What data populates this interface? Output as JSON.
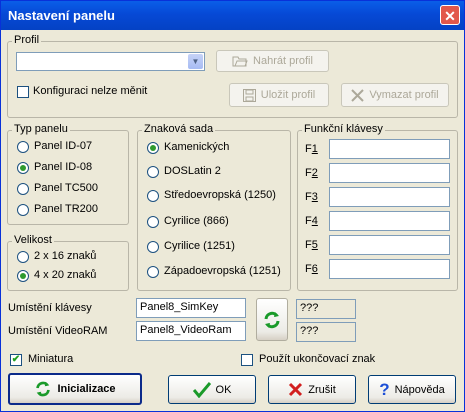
{
  "window": {
    "title": "Nastavení panelu",
    "close_symbol": "✕"
  },
  "profile": {
    "group_label": "Profil",
    "selected": "",
    "load_label": "Nahrát profil",
    "save_label": "Uložit profil",
    "delete_label": "Vymazat profil",
    "lock_label": "Konfiguraci nelze měnit",
    "lock_checked": false
  },
  "panel_type": {
    "group_label": "Typ panelu",
    "options": [
      "Panel ID-07",
      "Panel ID-08",
      "Panel TC500",
      "Panel TR200"
    ],
    "selected": "Panel ID-08"
  },
  "size": {
    "group_label": "Velikost",
    "options": [
      "2 x 16 znaků",
      "4 x 20 znaků"
    ],
    "selected": "4 x 20 znaků"
  },
  "charset": {
    "group_label": "Znaková sada",
    "options": [
      "Kamenických",
      "DOSLatin 2",
      "Středoevropská (1250)",
      "Cyrilice (866)",
      "Cyrilice (1251)",
      "Západoevropská (1251)"
    ],
    "selected": "Kamenických"
  },
  "function_keys": {
    "group_label": "Funkční klávesy",
    "keys": [
      {
        "prefix": "F",
        "num": "1",
        "value": ""
      },
      {
        "prefix": "F",
        "num": "2",
        "value": ""
      },
      {
        "prefix": "F",
        "num": "3",
        "value": ""
      },
      {
        "prefix": "F",
        "num": "4",
        "value": ""
      },
      {
        "prefix": "F",
        "num": "5",
        "value": ""
      },
      {
        "prefix": "F",
        "num": "6",
        "value": ""
      }
    ]
  },
  "locations": {
    "keys_label": "Umístění klávesy",
    "keys_value": "Panel8_SimKey",
    "keys_status": "???",
    "videoram_label": "Umístění VideoRAM",
    "videoram_value": "Panel8_VideoRam",
    "videoram_status": "???"
  },
  "options": {
    "thumbnail_label": "Miniatura",
    "thumbnail_checked": true,
    "terminator_label": "Použít ukončovací znak",
    "terminator_checked": false,
    "check_mark": "✔"
  },
  "buttons": {
    "init_label": "Inicializace",
    "ok_label": "OK",
    "cancel_label": "Zrušit",
    "help_label": "Nápověda"
  },
  "colors": {
    "title_bar": "#0649d6",
    "window_bg": "#ece9d8",
    "close": "#e2574a"
  }
}
